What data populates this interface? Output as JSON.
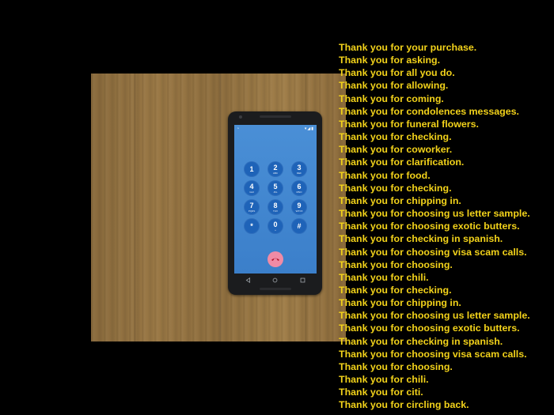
{
  "photo": {
    "board_color": "#9a7845",
    "phone": {
      "status_bar": {
        "icons": "▾◢▮"
      },
      "keypad": [
        {
          "digit": "1",
          "letters": ""
        },
        {
          "digit": "2",
          "letters": "ABC"
        },
        {
          "digit": "3",
          "letters": "DEF"
        },
        {
          "digit": "4",
          "letters": "GHI"
        },
        {
          "digit": "5",
          "letters": "JKL"
        },
        {
          "digit": "6",
          "letters": "MNO"
        },
        {
          "digit": "7",
          "letters": "PQRS"
        },
        {
          "digit": "8",
          "letters": "TUV"
        },
        {
          "digit": "9",
          "letters": "WXYZ"
        },
        {
          "digit": "*",
          "letters": ""
        },
        {
          "digit": "0",
          "letters": "+"
        },
        {
          "digit": "#",
          "letters": ""
        }
      ],
      "end_call_icon": "phone-hangup-icon",
      "end_call_color": "#f08ba5",
      "nav_icons": [
        "back-icon",
        "home-icon",
        "recents-icon"
      ]
    }
  },
  "captions": [
    "Thank you for your purchase.",
    "Thank you for asking.",
    "Thank you for all you do.",
    "Thank you for allowing.",
    "Thank you for coming.",
    "Thank you for condolences messages.",
    "Thank you for funeral flowers.",
    "Thank you for checking.",
    "Thank you for coworker.",
    "Thank you for clarification.",
    "Thank you for food.",
    "Thank you for checking.",
    "Thank you for chipping in.",
    "Thank you for choosing us letter sample.",
    "Thank you for choosing exotic butters.",
    "Thank you for checking in spanish.",
    "Thank you for choosing visa scam calls.",
    "Thank you for choosing.",
    "Thank you for chili.",
    "Thank you for checking.",
    "Thank you for chipping in.",
    "Thank you for choosing us letter sample.",
    "Thank you for choosing exotic butters.",
    "Thank you for checking in spanish.",
    "Thank you for choosing visa scam calls.",
    "Thank you for choosing.",
    "Thank you for chili.",
    "Thank you for citi.",
    "Thank you for circling back."
  ],
  "caption_color": "#f2d21a"
}
